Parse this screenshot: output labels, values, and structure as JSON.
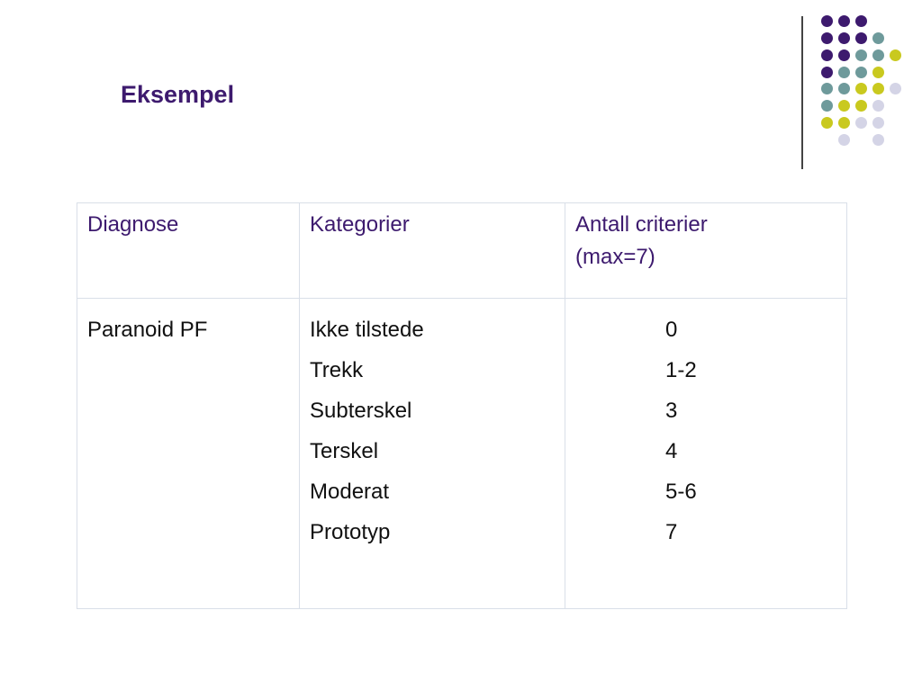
{
  "slide": {
    "title": "Eksempel"
  },
  "table": {
    "headers": [
      "Diagnose",
      "Kategorier",
      "Antall criterier (max=7)"
    ],
    "header_lines": {
      "col3_line1": "Antall criterier",
      "col3_line2": "(max=7)"
    },
    "row": {
      "diagnose": "Paranoid PF",
      "kategorier": [
        "Ikke tilstede",
        "Trekk",
        "Subterskel",
        "Terskel",
        "Moderat",
        "Prototyp"
      ],
      "antall": [
        "0",
        "1-2",
        "3",
        "4",
        "5-6",
        "7"
      ]
    }
  },
  "colors": {
    "title": "#3d1a6e",
    "header_text": "#3d1a6e",
    "dot_purple": "#3d1a6e",
    "dot_teal": "#6e9a9b",
    "dot_yellow": "#c9c91f",
    "dot_lavender": "#d4d4e6",
    "divider": "#444444",
    "table_border": "#d9dfe8"
  }
}
